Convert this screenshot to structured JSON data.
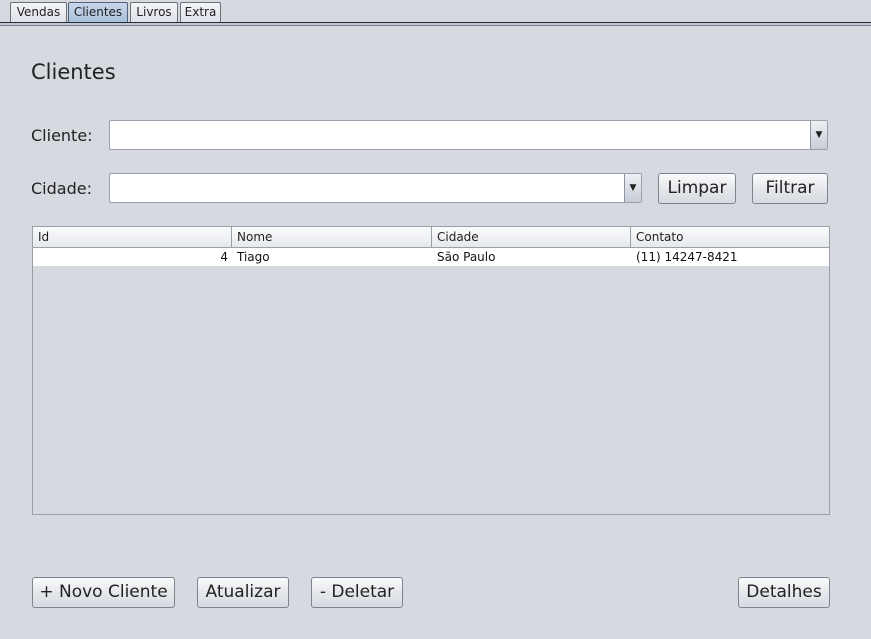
{
  "tabs": [
    {
      "label": "Vendas"
    },
    {
      "label": "Clientes"
    },
    {
      "label": "Livros"
    },
    {
      "label": "Extra"
    }
  ],
  "selected_tab": "Clientes",
  "page_title": "Clientes",
  "filters": {
    "cliente_label": "Cliente:",
    "cliente_value": "",
    "cidade_label": "Cidade:",
    "cidade_value": "",
    "limpar_label": "Limpar",
    "filtrar_label": "Filtrar"
  },
  "table": {
    "columns": [
      "Id",
      "Nome",
      "Cidade",
      "Contato"
    ],
    "rows": [
      {
        "id": "4",
        "nome": "Tiago",
        "cidade": "São Paulo",
        "contato": "(11) 14247-8421"
      }
    ]
  },
  "actions": {
    "novo_label": "+ Novo Cliente",
    "atualizar_label": "Atualizar",
    "deletar_label": "- Deletar",
    "detalhes_label": "Detalhes"
  },
  "icons": {
    "combo_arrow": "chevron-down-icon"
  }
}
